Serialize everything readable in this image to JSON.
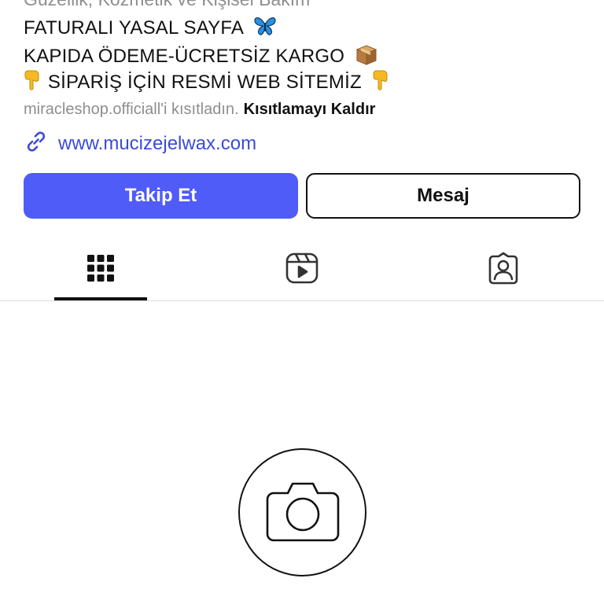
{
  "profile": {
    "category": "Güzellik, Kozmetik ve Kişisel Bakım",
    "bio": {
      "line1": "FATURALI YASAL SAYFA",
      "line2": "KAPIDA ÖDEME-ÜCRETSİZ KARGO",
      "line3": "SİPARİŞ İÇİN RESMİ WEB SİTEMİZ",
      "line1_emoji": "butterfly",
      "line2_emoji": "package",
      "line3_emoji": "backhand-index-pointing-down"
    },
    "restriction": {
      "text": "miracleshop.officiall'i kısıtladın.",
      "action": "Kısıtlamayı Kaldır"
    },
    "website": {
      "url": "www.mucizejelwax.com",
      "icon": "link-icon"
    }
  },
  "actions": {
    "follow_label": "Takip Et",
    "message_label": "Mesaj"
  },
  "tabs": [
    {
      "name": "posts",
      "icon": "grid-icon",
      "active": true
    },
    {
      "name": "reels",
      "icon": "reels-icon",
      "active": false
    },
    {
      "name": "tagged",
      "icon": "tagged-icon",
      "active": false
    }
  ],
  "empty_state": {
    "icon": "camera-icon"
  },
  "colors": {
    "accent": "#4f5cf7",
    "link": "#3b4bd6",
    "muted": "#8e8e8e",
    "text": "#111111",
    "divider": "#dbdbdb"
  }
}
